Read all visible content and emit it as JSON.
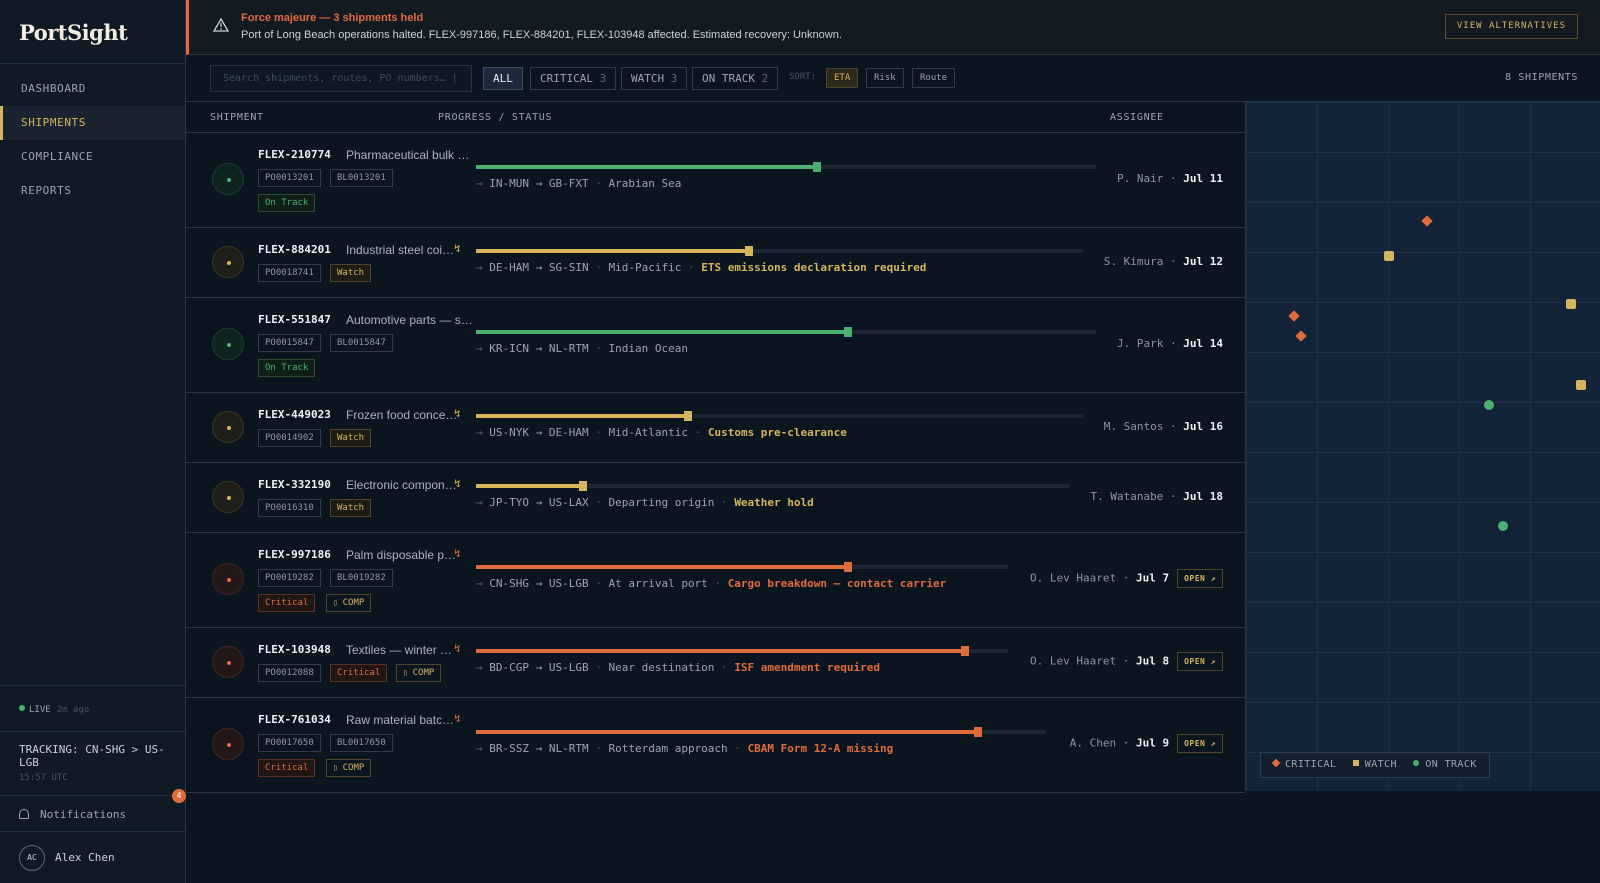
{
  "app": {
    "name": "PortSight"
  },
  "nav": [
    {
      "label": "DASHBOARD",
      "active": false
    },
    {
      "label": "SHIPMENTS",
      "active": true
    },
    {
      "label": "COMPLIANCE",
      "active": false
    },
    {
      "label": "REPORTS",
      "active": false
    }
  ],
  "status": {
    "live_label": "LIVE",
    "ago": "2m ago",
    "tracking": "TRACKING: CN-SHG > US-LGB",
    "time": "15:57 UTC"
  },
  "notifications": {
    "label": "Notifications",
    "count": "4"
  },
  "user": {
    "initials": "AC",
    "name": "Alex Chen"
  },
  "banner": {
    "title": "Force majeure — 3 shipments held",
    "text": "Port of Long Beach operations halted. FLEX-997186, FLEX-884201, FLEX-103948 affected. Estimated recovery: Unknown.",
    "button": "VIEW ALTERNATIVES"
  },
  "toolbar": {
    "search_placeholder": "Search shipments, routes, PO numbers… |",
    "filters": [
      {
        "label": "ALL",
        "count": ""
      },
      {
        "label": "CRITICAL",
        "count": "3"
      },
      {
        "label": "WATCH",
        "count": "3"
      },
      {
        "label": "ON TRACK",
        "count": "2"
      }
    ],
    "sort_label": "SORT:",
    "sorts": [
      "ETA",
      "Risk",
      "Route"
    ],
    "count_text": "8 SHIPMENTS"
  },
  "table": {
    "headers": {
      "shipment": "SHIPMENT",
      "progress": "PROGRESS / STATUS",
      "assignee": "ASSIGNEE"
    },
    "rows": [
      {
        "id": "FLEX-210774",
        "desc": "Pharmaceutical bulk …",
        "po": "PO0013201",
        "bl": "BL0013201",
        "status": "On Track",
        "comp": "",
        "route": "IN-MUN → GB-FXT",
        "location": "Arabian Sea",
        "alert": "",
        "assignee": "P. Nair",
        "eta": "Jul 11",
        "open": "",
        "progress": 0.55
      },
      {
        "id": "FLEX-884201",
        "desc": "Industrial steel coi…",
        "po": "PO0018741",
        "bl": "",
        "status": "Watch",
        "comp": "",
        "route": "DE-HAM → SG-SIN",
        "location": "Mid-Pacific",
        "alert": "ETS emissions declaration required",
        "assignee": "S. Kimura",
        "eta": "Jul 12",
        "open": "",
        "progress": 0.45
      },
      {
        "id": "FLEX-551847",
        "desc": "Automotive parts — s…",
        "po": "PO0015847",
        "bl": "BL0015847",
        "status": "On Track",
        "comp": "",
        "route": "KR-ICN → NL-RTM",
        "location": "Indian Ocean",
        "alert": "",
        "assignee": "J. Park",
        "eta": "Jul 14",
        "open": "",
        "progress": 0.6
      },
      {
        "id": "FLEX-449023",
        "desc": "Frozen food conce…",
        "po": "PO0014902",
        "bl": "",
        "status": "Watch",
        "comp": "",
        "route": "US-NYK → DE-HAM",
        "location": "Mid-Atlantic",
        "alert": "Customs pre-clearance",
        "assignee": "M. Santos",
        "eta": "Jul 16",
        "open": "",
        "progress": 0.35
      },
      {
        "id": "FLEX-332190",
        "desc": "Electronic compon…",
        "po": "PO0016310",
        "bl": "",
        "status": "Watch",
        "comp": "",
        "route": "JP-TYO → US-LAX",
        "location": "Departing origin",
        "alert": "Weather hold",
        "assignee": "T. Watanabe",
        "eta": "Jul 18",
        "open": "",
        "progress": 0.18
      },
      {
        "id": "FLEX-997186",
        "desc": "Palm disposable p…",
        "po": "PO0019282",
        "bl": "BL0019282",
        "status": "Critical",
        "comp": "COMP",
        "route": "CN-SHG → US-LGB",
        "location": "At arrival port",
        "alert": "Cargo breakdown — contact carrier",
        "assignee": "O. Lev Haaret",
        "eta": "Jul 7",
        "open": "OPEN",
        "progress": 0.7
      },
      {
        "id": "FLEX-103948",
        "desc": "Textiles — winter …",
        "po": "PO0012088",
        "bl": "",
        "status": "Critical",
        "comp": "COMP",
        "route": "BD-CGP → US-LGB",
        "location": "Near destination",
        "alert": "ISF amendment required",
        "assignee": "O. Lev Haaret",
        "eta": "Jul 8",
        "open": "OPEN",
        "progress": 0.92
      },
      {
        "id": "FLEX-761034",
        "desc": "Raw material batc…",
        "po": "PO0017650",
        "bl": "BL0017650",
        "status": "Critical",
        "comp": "COMP",
        "route": "BR-SSZ → NL-RTM",
        "location": "Rotterdam approach",
        "alert": "CBAM Form 12-A missing",
        "assignee": "A. Chen",
        "eta": "Jul 9",
        "open": "OPEN",
        "progress": 0.88
      }
    ]
  },
  "map": {
    "legend": [
      {
        "label": "CRITICAL",
        "shape": "diamond"
      },
      {
        "label": "WATCH",
        "shape": "square"
      },
      {
        "label": "ON TRACK",
        "shape": "circle"
      }
    ]
  },
  "colors": {
    "critical": "#e06c3c",
    "watch": "#d6b45c",
    "on_track": "#4caf70",
    "accent": "#d6b45c",
    "background": "#0b1520"
  },
  "icons": {
    "warning": "warning-triangle-icon",
    "bell": "bell-icon",
    "bolt": "bolt-icon",
    "external": "external-link-icon"
  }
}
